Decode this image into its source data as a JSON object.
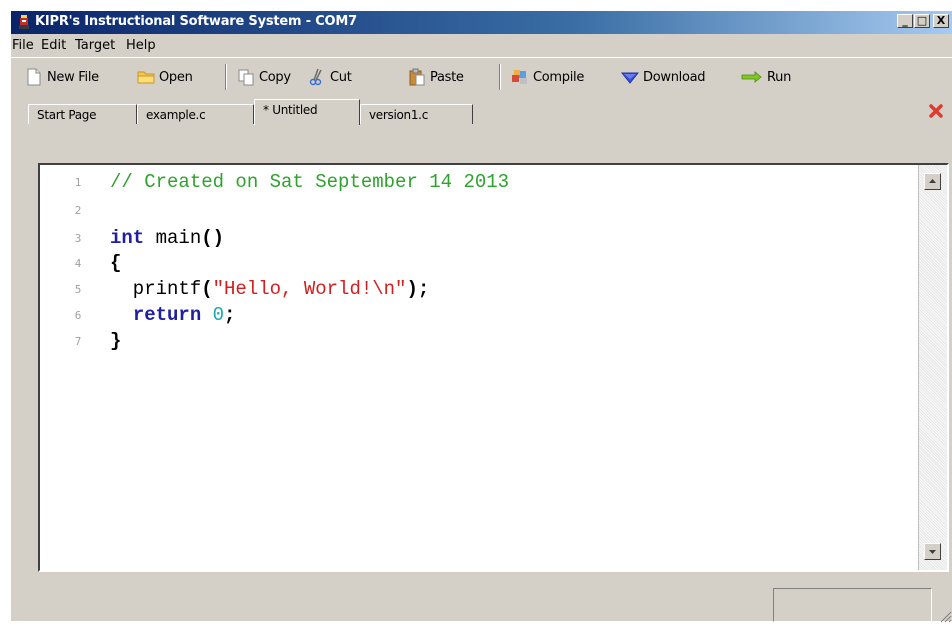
{
  "window": {
    "title": "KIPR's Instructional Software System - COM7",
    "controls": {
      "minimize": "_",
      "maximize": "□",
      "close": "X"
    }
  },
  "menu": [
    "File",
    "Edit",
    "Target",
    "Help"
  ],
  "toolbar": {
    "new_file": "New File",
    "open": "Open",
    "copy": "Copy",
    "cut": "Cut",
    "paste": "Paste",
    "compile": "Compile",
    "download": "Download",
    "run": "Run"
  },
  "tabs": [
    {
      "label": "Start Page",
      "active": false
    },
    {
      "label": "example.c",
      "active": false
    },
    {
      "label": "* Untitled",
      "active": true
    },
    {
      "label": "version1.c",
      "active": false
    }
  ],
  "editor": {
    "line_numbers": [
      "1",
      "2",
      "3",
      "4",
      "5",
      "6",
      "7"
    ],
    "lines": {
      "l1_comment": "// Created on Sat September 14 2013",
      "l3_kw": "int",
      "l3_rest": " main",
      "l3_paren": "()",
      "l4_brace": "{",
      "l5_indent": "  printf",
      "l5_paren_open": "(",
      "l5_str": "\"Hello, World!\\n\"",
      "l5_paren_close": ");",
      "l6_indent": "  ",
      "l6_kw": "return",
      "l6_space": " ",
      "l6_num": "0",
      "l6_semi": ";",
      "l7_brace": "}"
    }
  },
  "colors": {
    "comment": "#2ea32e",
    "keyword": "#1f1f9f",
    "string": "#d21e1e",
    "number": "#1aa5b5",
    "close_tab": "#e03a2f"
  }
}
